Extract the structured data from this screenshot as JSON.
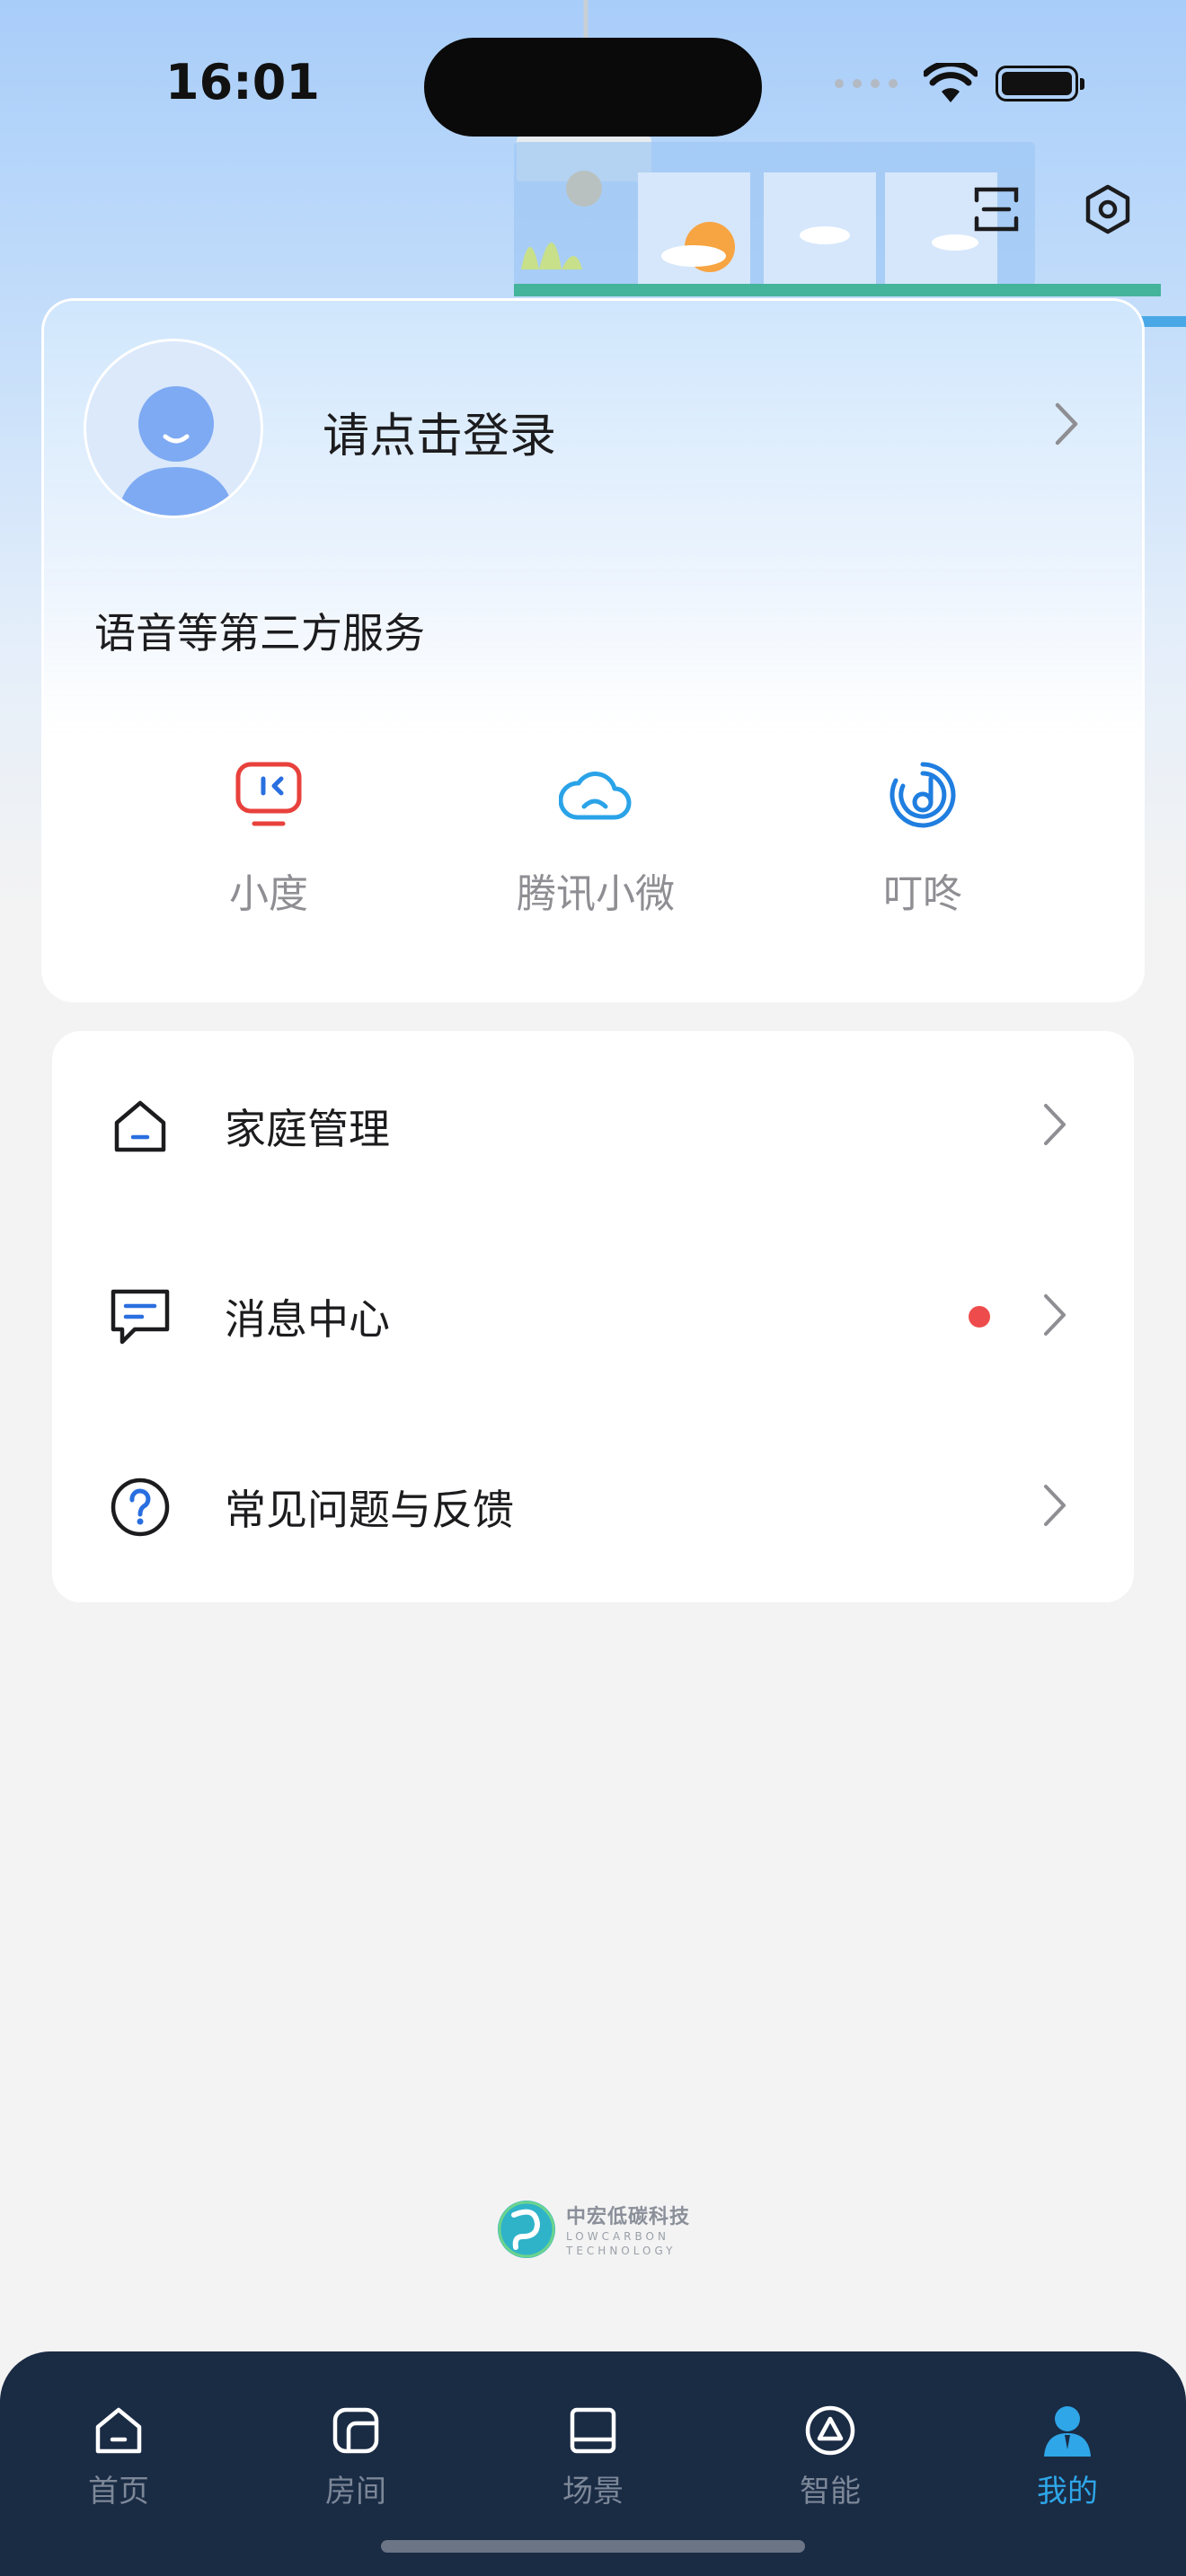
{
  "status_bar": {
    "time": "16:01"
  },
  "header": {
    "scan_icon": "scan-icon",
    "settings_icon": "settings-icon"
  },
  "profile": {
    "login_prompt": "请点击登录",
    "services_title": "语音等第三方服务",
    "services": [
      {
        "label": "小度",
        "icon": "xiaodu-icon",
        "color": "#e8413c"
      },
      {
        "label": "腾讯小微",
        "icon": "cloud-icon",
        "color": "#2aa3e8"
      },
      {
        "label": "叮咚",
        "icon": "dingdong-icon",
        "color": "#1f7ee0"
      }
    ]
  },
  "menu": {
    "items": [
      {
        "label": "家庭管理",
        "icon": "home-icon",
        "badge": false
      },
      {
        "label": "消息中心",
        "icon": "message-icon",
        "badge": true
      },
      {
        "label": "常见问题与反馈",
        "icon": "help-icon",
        "badge": false
      }
    ]
  },
  "brand": {
    "name_cn": "中宏低碳科技",
    "name_en_1": "LOWCARBON",
    "name_en_2": "TECHNOLOGY"
  },
  "tabbar": {
    "tabs": [
      {
        "label": "首页",
        "icon": "home-tab-icon",
        "active": false
      },
      {
        "label": "房间",
        "icon": "room-tab-icon",
        "active": false
      },
      {
        "label": "场景",
        "icon": "scene-tab-icon",
        "active": false
      },
      {
        "label": "智能",
        "icon": "smart-tab-icon",
        "active": false
      },
      {
        "label": "我的",
        "icon": "profile-tab-icon",
        "active": true
      }
    ],
    "active_color": "#2ea6e8",
    "background": "#1a2b44"
  }
}
